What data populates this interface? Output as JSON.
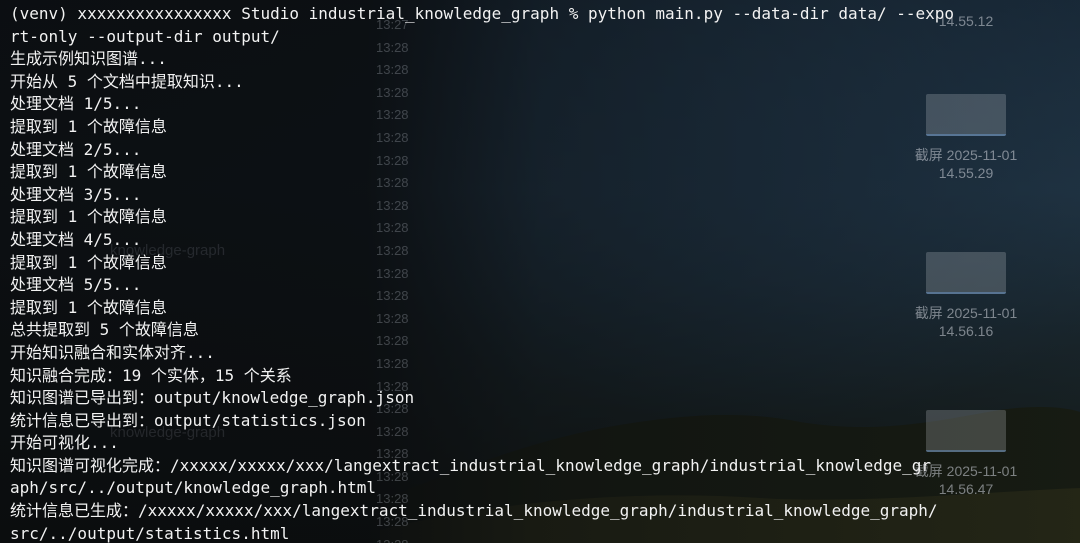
{
  "desktop": {
    "clock_entries": [
      "13:27",
      "13:28",
      "13:28",
      "13:28",
      "13:28",
      "13:28",
      "13:28",
      "13:28",
      "13:28",
      "13:28",
      "13:28",
      "13:28",
      "13:28",
      "13:28",
      "13:28",
      "13:28",
      "13:28",
      "13:28",
      "13:28",
      "13:28",
      "13:28",
      "13:28",
      "13:28",
      "13:28"
    ],
    "icons": [
      {
        "caption_line1": "",
        "caption_line2": "14.55.12"
      },
      {
        "caption_line1": "截屏 2025-11-01",
        "caption_line2": "14.55.29"
      },
      {
        "caption_line1": "截屏 2025-11-01",
        "caption_line2": "14.56.16"
      },
      {
        "caption_line1": "截屏 2025-11-01",
        "caption_line2": "14.56.47"
      }
    ],
    "ghost_labels": [
      "knowledge-graph",
      "knowledge-graph"
    ]
  },
  "terminal": {
    "lines": [
      "(venv) xxxxxxxxxxxxxxxx Studio industrial_knowledge_graph % python main.py --data-dir data/ --expo",
      "rt-only --output-dir output/",
      "生成示例知识图谱...",
      "开始从 5 个文档中提取知识...",
      "处理文档 1/5...",
      "提取到 1 个故障信息",
      "处理文档 2/5...",
      "提取到 1 个故障信息",
      "处理文档 3/5...",
      "提取到 1 个故障信息",
      "处理文档 4/5...",
      "提取到 1 个故障信息",
      "处理文档 5/5...",
      "提取到 1 个故障信息",
      "总共提取到 5 个故障信息",
      "开始知识融合和实体对齐...",
      "知识融合完成：19 个实体，15 个关系",
      "知识图谱已导出到：output/knowledge_graph.json",
      "统计信息已导出到：output/statistics.json",
      "开始可视化...",
      "知识图谱可视化完成：/xxxxx/xxxxx/xxx/langextract_industrial_knowledge_graph/industrial_knowledge_gr",
      "aph/src/../output/knowledge_graph.html",
      "统计信息已生成：/xxxxx/xxxxx/xxx/langextract_industrial_knowledge_graph/industrial_knowledge_graph/",
      "src/../output/statistics.html"
    ]
  }
}
